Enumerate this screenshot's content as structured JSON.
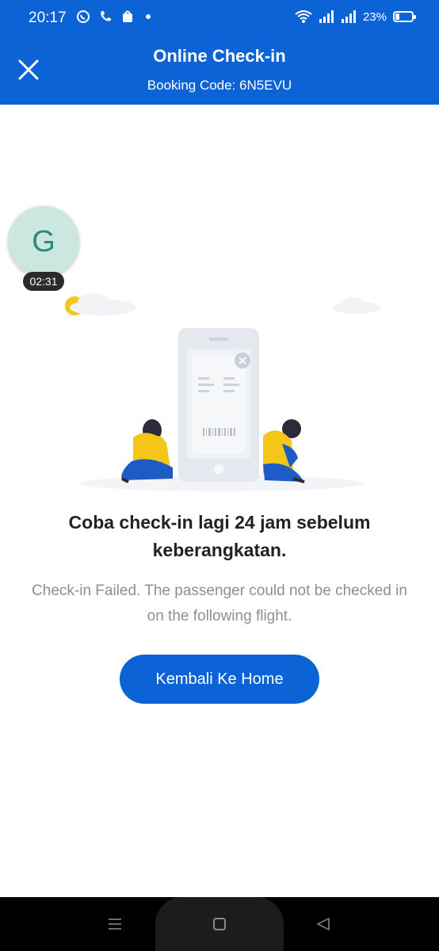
{
  "status_bar": {
    "time": "20:17",
    "battery": "23%",
    "battery_level": 0.23
  },
  "header": {
    "title": "Online Check-in",
    "booking_code": "Booking Code: 6N5EVU"
  },
  "chat_bubble": {
    "initial": "G",
    "timer": "02:31"
  },
  "message": {
    "headline": "Coba check-in lagi 24 jam sebelum keberangkatan.",
    "detail": "Check-in Failed. The passenger could not be checked in on the following flight."
  },
  "actions": {
    "home_label": "Kembali Ke Home"
  },
  "colors": {
    "primary": "#0b63d6",
    "accent_yellow": "#f5c518"
  },
  "icons": {
    "close": "close-icon",
    "nav_menu": "menu-icon",
    "nav_home": "home-square-icon",
    "nav_back": "back-triangle-icon"
  }
}
